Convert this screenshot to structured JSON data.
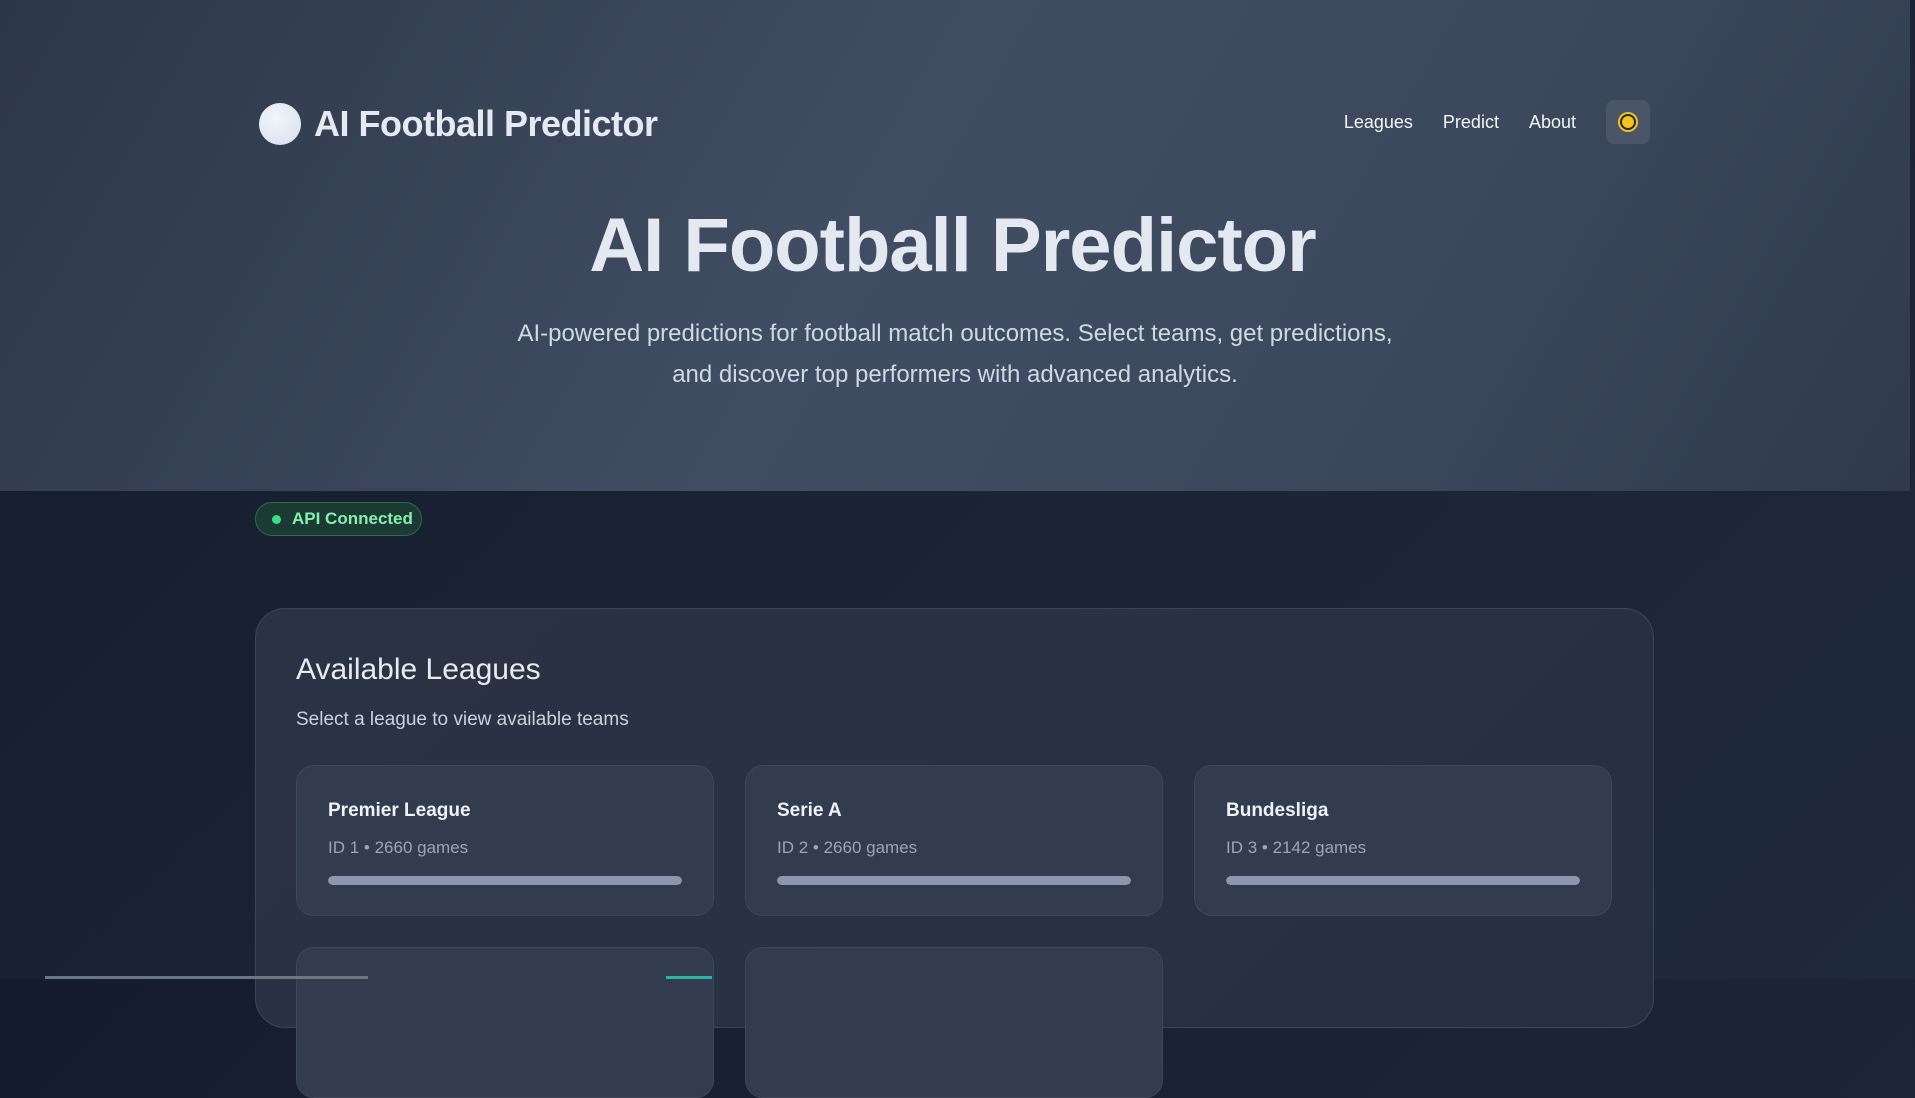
{
  "header": {
    "brand_title": "AI Football Predictor",
    "nav": [
      {
        "label": "Leagues"
      },
      {
        "label": "Predict"
      },
      {
        "label": "About"
      }
    ],
    "theme_toggle_icon": "sun-icon"
  },
  "hero": {
    "title": "AI Football Predictor",
    "subtitle_line1": "AI-powered predictions for football match outcomes. Select teams, get predictions,",
    "subtitle_line2": "and discover top performers with advanced analytics."
  },
  "status": {
    "label": "API Connected",
    "color": "#3ddc84"
  },
  "leagues": {
    "title": "Available Leagues",
    "subtitle": "Select a league to view available teams",
    "items": [
      {
        "name": "Premier League",
        "meta": "ID 1 • 2660 games",
        "progress": 1.0
      },
      {
        "name": "Serie A",
        "meta": "ID 2 • 2660 games",
        "progress": 1.0
      },
      {
        "name": "Bundesliga",
        "meta": "ID 3 • 2142 games",
        "progress": 1.0
      }
    ]
  }
}
